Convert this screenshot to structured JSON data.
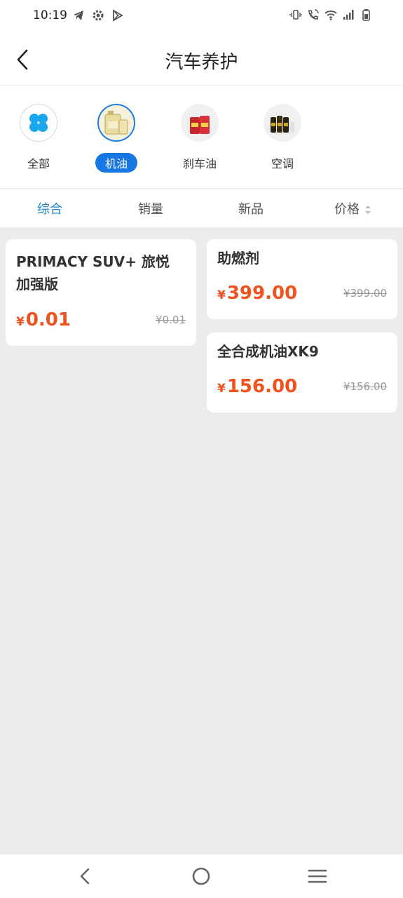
{
  "status": {
    "time": "10:19"
  },
  "header": {
    "title": "汽车养护"
  },
  "categories": [
    {
      "label": "全部"
    },
    {
      "label": "机油"
    },
    {
      "label": "刹车油"
    },
    {
      "label": "空调"
    }
  ],
  "sort": [
    {
      "label": "综合"
    },
    {
      "label": "销量"
    },
    {
      "label": "新品"
    },
    {
      "label": "价格"
    }
  ],
  "products": [
    {
      "name": "PRIMACY SUV+ 旅悦 加强版",
      "currency": "¥",
      "price": "0.01",
      "original_price": "¥0.01"
    },
    {
      "name": "助燃剂",
      "currency": "¥",
      "price": "399.00",
      "original_price": "¥399.00"
    },
    {
      "name": "全合成机油XK9",
      "currency": "¥",
      "price": "156.00",
      "original_price": "¥156.00"
    }
  ],
  "colors": {
    "accent": "#1677e5",
    "price": "#f0521e",
    "active_sort": "#1e88c9"
  }
}
